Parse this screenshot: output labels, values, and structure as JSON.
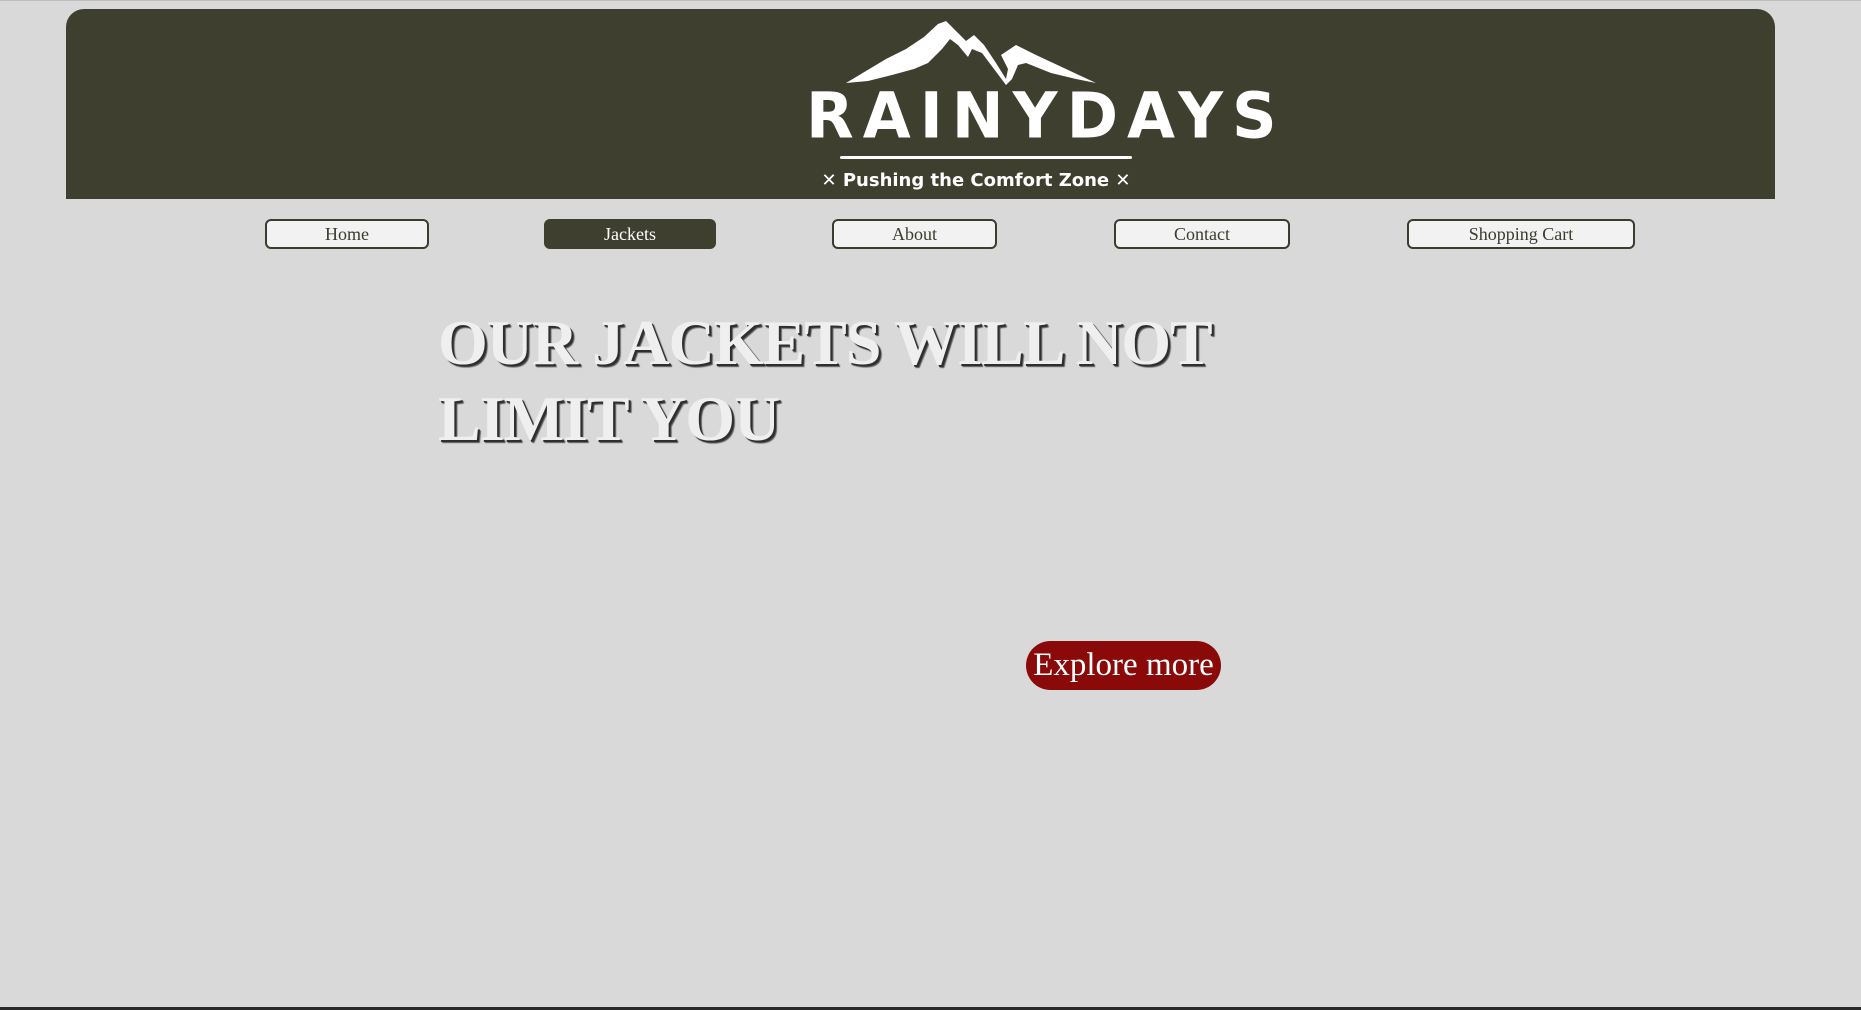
{
  "brand": {
    "name": "RAINYDAYS",
    "tagline": "✕ Pushing the Comfort Zone ✕",
    "header_color": "#3e3f2f"
  },
  "nav": {
    "items": [
      {
        "label": "Home",
        "active": false
      },
      {
        "label": "Jackets",
        "active": true
      },
      {
        "label": "About",
        "active": false
      },
      {
        "label": "Contact",
        "active": false
      },
      {
        "label": "Shopping Cart",
        "active": false
      }
    ]
  },
  "hero": {
    "title": "OUR JACKETS WILL NOT LIMIT YOU",
    "cta_label": "Explore more",
    "cta_color": "#8a0a0a"
  }
}
